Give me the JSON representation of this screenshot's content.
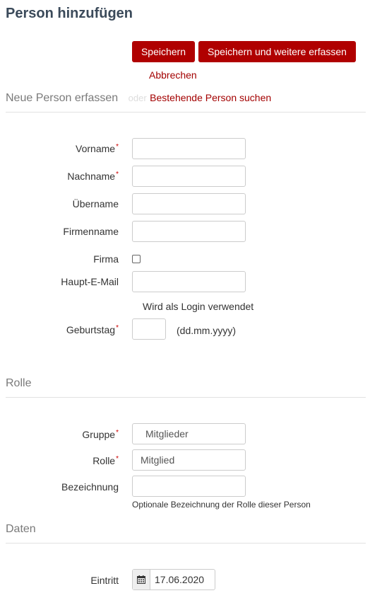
{
  "page": {
    "title": "Person hinzufügen"
  },
  "actions": {
    "save": "Speichern",
    "save_more": "Speichern und weitere erfassen",
    "cancel": "Abbrechen"
  },
  "new_person": {
    "heading": "Neue Person erfassen",
    "or": "oder",
    "search_link": "Bestehende Person suchen"
  },
  "fields": {
    "vorname": {
      "label": "Vorname",
      "required": "*",
      "value": ""
    },
    "nachname": {
      "label": "Nachname",
      "required": "*",
      "value": ""
    },
    "uebername": {
      "label": "Übername",
      "value": ""
    },
    "firmenname": {
      "label": "Firmenname",
      "value": ""
    },
    "firma": {
      "label": "Firma",
      "checked": false
    },
    "email": {
      "label": "Haupt-E-Mail",
      "value": "",
      "help": "Wird als Login verwendet"
    },
    "geburtstag": {
      "label": "Geburtstag",
      "required": "*",
      "value": "",
      "format_hint": "(dd.mm.yyyy)"
    }
  },
  "role_section": {
    "heading": "Rolle",
    "gruppe": {
      "label": "Gruppe",
      "required": "*",
      "value": "Mitglieder"
    },
    "rolle": {
      "label": "Rolle",
      "required": "*",
      "value": "Mitglied"
    },
    "bezeichnung": {
      "label": "Bezeichnung",
      "value": "",
      "help": "Optionale Bezeichnung der Rolle dieser Person"
    }
  },
  "data_section": {
    "heading": "Daten",
    "eintritt": {
      "label": "Eintritt",
      "value": "17.06.2020",
      "icon": "calendar-icon"
    }
  },
  "colors": {
    "accent": "#b00000",
    "link": "#a30000",
    "required": "#cc0000"
  }
}
